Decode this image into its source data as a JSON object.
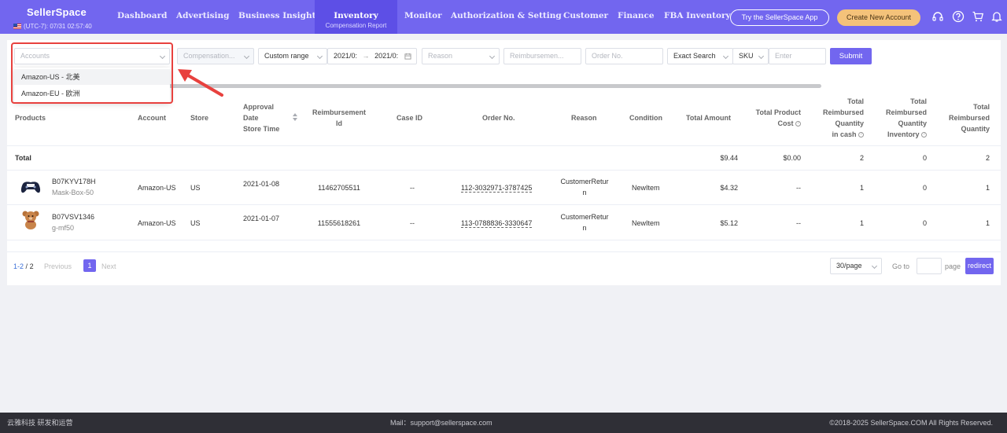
{
  "header": {
    "brand": "SellerSpace",
    "timezone": "(UTC-7): 07/31 02:57:40",
    "nav": [
      "Dashboard",
      "Advertising",
      "Business Insight"
    ],
    "active_nav": {
      "title": "Inventory",
      "subtitle": "Compensation Report"
    },
    "nav_right": [
      "Monitor",
      "Authorization & Setting",
      "Customer",
      "Finance",
      "FBA Inventory"
    ],
    "try_app": "Try the SellerSpace App",
    "create_account": "Create New Account",
    "icons": [
      "headset-icon",
      "help-icon",
      "cart-icon",
      "bell-icon"
    ]
  },
  "filters": {
    "accounts_placeholder": "Accounts",
    "compensation_placeholder": "Compensation...",
    "date_type": "Custom range",
    "date_start": "2021/0:",
    "date_end": "2021/0:",
    "date_sep": "→",
    "reason_placeholder": "Reason",
    "reimbursement_placeholder": "Reimbursemen...",
    "order_placeholder": "Order No.",
    "match_type": "Exact Search",
    "field_type": "SKU",
    "enter_placeholder": "Enter",
    "submit": "Submit"
  },
  "accounts_dropdown": {
    "options": [
      "Amazon-US - 北美",
      "Amazon-EU - 欧洲"
    ]
  },
  "table": {
    "headers": {
      "products": "Products",
      "account": "Account",
      "store": "Store",
      "approval": [
        "Approval",
        "Date",
        "Store Time"
      ],
      "reimbursement_id": [
        "Reimbursement",
        "Id"
      ],
      "case_id": "Case ID",
      "order_no": "Order No.",
      "reason": "Reason",
      "condition": "Condition",
      "total_amount": "Total Amount",
      "total_product_cost": [
        "Total Product",
        "Cost"
      ],
      "reimbursed_cash": [
        "Total",
        "Reimbursed",
        "Quantity",
        "in cash"
      ],
      "reimbursed_inventory": [
        "Total",
        "Reimbursed",
        "Quantity",
        "Inventory"
      ],
      "reimbursed_total": [
        "Total",
        "Reimbursed",
        "Quantity"
      ]
    },
    "total_row": {
      "label": "Total",
      "amount": "$9.44",
      "cost": "$0.00",
      "cash": "2",
      "inventory": "0",
      "quantity": "2"
    },
    "rows": [
      {
        "asin": "B07KYV178H",
        "sku": "Mask-Box-50",
        "account": "Amazon-US",
        "store": "US",
        "date": "2021-01-08",
        "reimbursement_id": "11462705511",
        "case_id": "--",
        "order_no": "112-3032971-3787425",
        "reason_1": "CustomerRetur",
        "reason_2": "n",
        "condition": "NewItem",
        "amount": "$4.32",
        "cost": "--",
        "cash": "1",
        "inventory": "0",
        "quantity": "1"
      },
      {
        "asin": "B07VSV1346",
        "sku": "g-mf50",
        "account": "Amazon-US",
        "store": "US",
        "date": "2021-01-07",
        "reimbursement_id": "11555618261",
        "case_id": "--",
        "order_no": "113-0788836-3330647",
        "reason_1": "CustomerRetur",
        "reason_2": "n",
        "condition": "NewItem",
        "amount": "$5.12",
        "cost": "--",
        "cash": "1",
        "inventory": "0",
        "quantity": "1"
      }
    ]
  },
  "pagination": {
    "range": "1-2",
    "sep": "/",
    "total": "2",
    "previous": "Previous",
    "page": "1",
    "next": "Next",
    "per_page": "30/page",
    "goto": "Go to",
    "page_label": "page",
    "redirect": "redirect"
  },
  "footer": {
    "left": "云雅科技 研发和运营",
    "mail": "Mail：support@sellerspace.com",
    "copyright": "©2018-2025 SellerSpace.COM All Rights Reserved."
  }
}
